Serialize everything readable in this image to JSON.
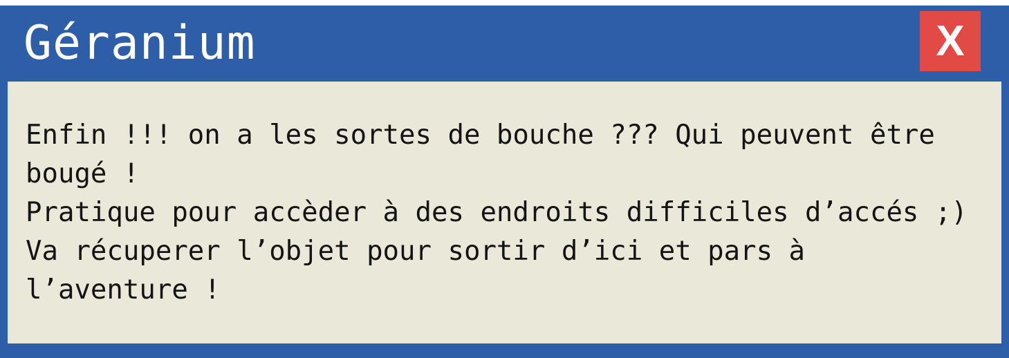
{
  "dialog": {
    "title": "Géranium",
    "close_label": "X",
    "lines": [
      "Enfin !!! on a les sortes de bouche ??? Qui peuvent être",
      "bougé !",
      "Pratique pour accèder à des endroits difficiles d’accés ;)",
      "Va récuperer l’objet pour sortir d’ici et pars à",
      "l’aventure !"
    ]
  },
  "colors": {
    "frame": "#2f5ea9",
    "panel": "#eae8d8",
    "close": "#e24b45",
    "title_text": "#ffffff",
    "body_text": "#141414"
  }
}
